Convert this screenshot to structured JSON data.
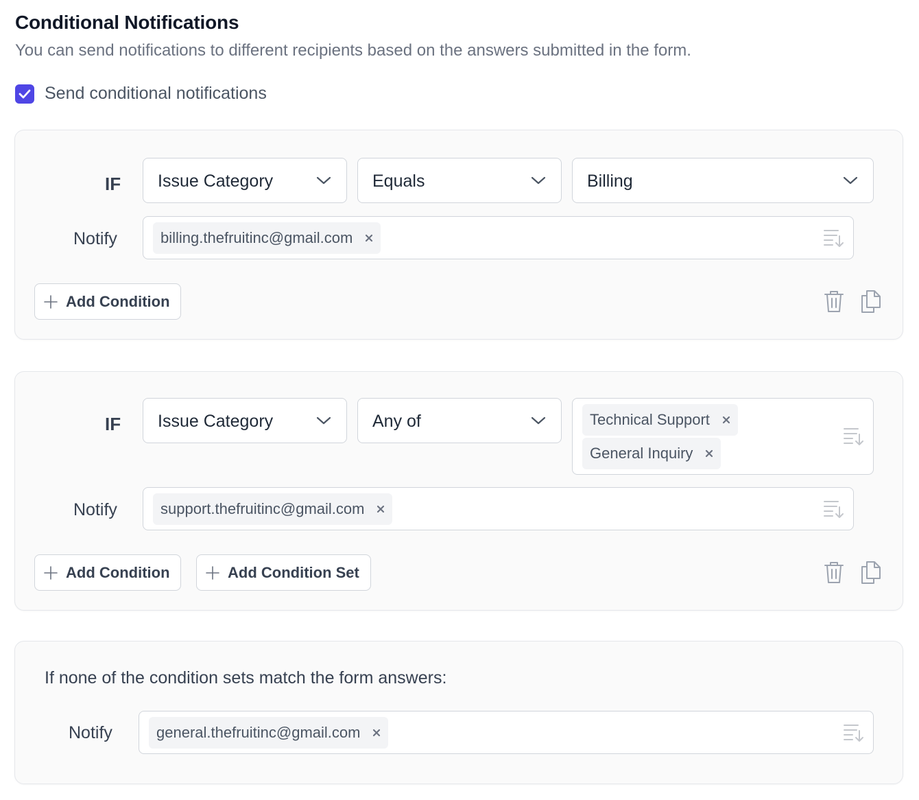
{
  "header": {
    "title": "Conditional Notifications",
    "subtitle": "You can send notifications to different recipients based on the answers submitted in the form."
  },
  "toggle": {
    "label": "Send conditional notifications",
    "checked": true,
    "accent_color": "#4f46e5"
  },
  "condition_sets": [
    {
      "if_label": "IF",
      "field": "Issue Category",
      "operator": "Equals",
      "value": "Billing",
      "notify_label": "Notify",
      "recipients": [
        "billing.thefruitinc@gmail.com"
      ],
      "buttons": {
        "add_condition": "Add Condition"
      },
      "icons": [
        "plus-icon",
        "trash-icon",
        "copy-icon",
        "chevron-down-icon",
        "sort-descending-icon",
        "close-icon"
      ]
    },
    {
      "if_label": "IF",
      "field": "Issue Category",
      "operator": "Any of",
      "values": [
        "Technical Support",
        "General Inquiry"
      ],
      "notify_label": "Notify",
      "recipients": [
        "support.thefruitinc@gmail.com"
      ],
      "buttons": {
        "add_condition": "Add Condition",
        "add_condition_set": "Add Condition Set"
      }
    }
  ],
  "fallback": {
    "text": "If none of the condition sets match the form answers:",
    "notify_label": "Notify",
    "recipients": [
      "general.thefruitinc@gmail.com"
    ]
  }
}
